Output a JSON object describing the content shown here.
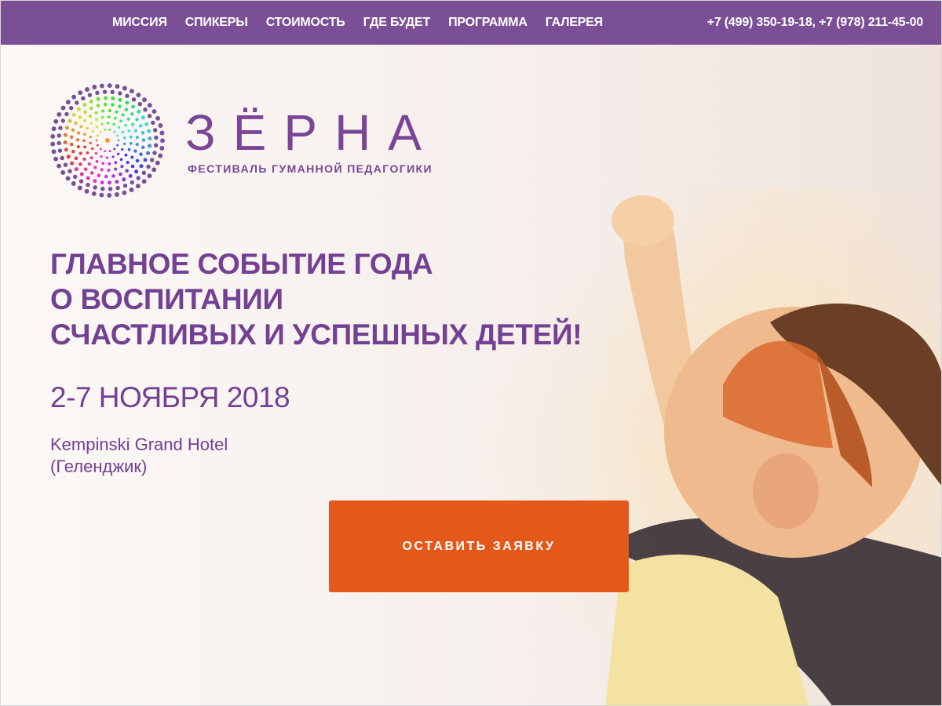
{
  "nav": {
    "items": [
      {
        "label": "МИССИЯ"
      },
      {
        "label": "СПИКЕРЫ"
      },
      {
        "label": "СТОИМОСТЬ"
      },
      {
        "label": "ГДЕ БУДЕТ"
      },
      {
        "label": "ПРОГРАММА"
      },
      {
        "label": "ГАЛЕРЕЯ"
      }
    ],
    "phones": "+7 (499) 350-19-18, +7 (978) 211-45-00",
    "background_color": "#7b4f96"
  },
  "logo": {
    "name": "ЗЁРНА",
    "tagline": "ФЕСТИВАЛЬ ГУМАННОЙ ПЕДАГОГИКИ"
  },
  "hero": {
    "headline_lines": [
      "ГЛАВНОЕ СОБЫТИЕ ГОДА",
      "О ВОСПИТАНИИ",
      "СЧАСТЛИВЫХ И УСПЕШНЫХ ДЕТЕЙ!"
    ],
    "date": "2-7 НОЯБРЯ 2018",
    "venue_lines": [
      "Kempinski Grand Hotel",
      "(Геленджик)"
    ],
    "cta_label": "ОСТАВИТЬ ЗАЯВКУ",
    "text_color": "#734093",
    "cta_color": "#e4591a"
  }
}
